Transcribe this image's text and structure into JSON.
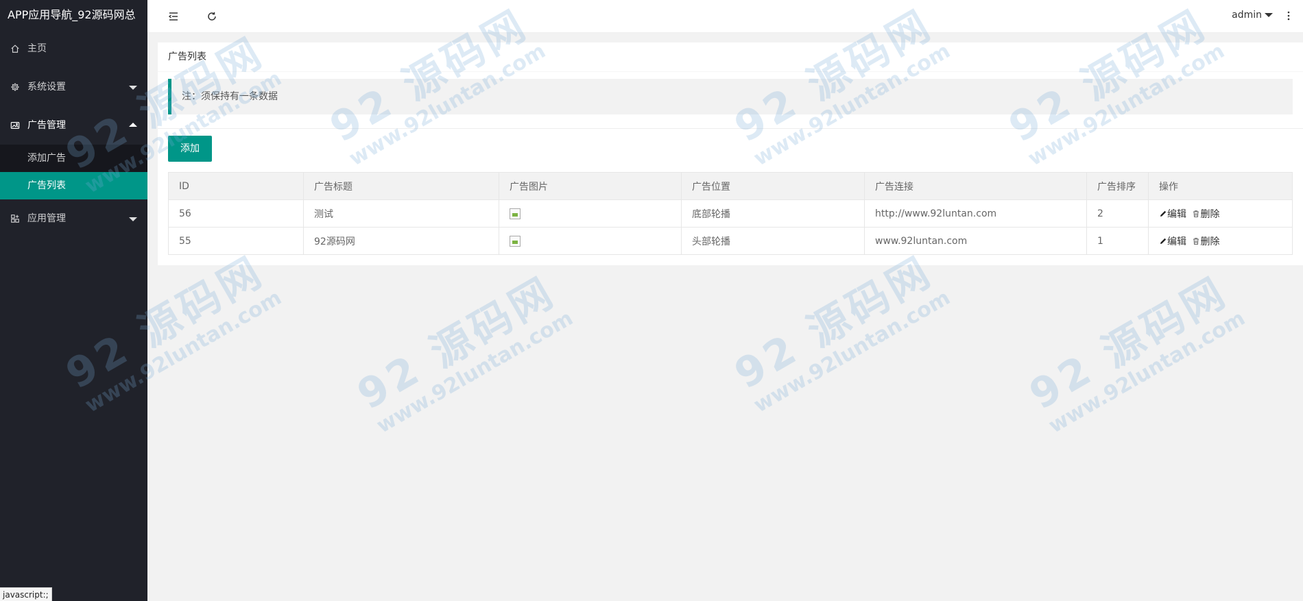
{
  "app": {
    "title": "APP应用导航_92源码网总"
  },
  "sidebar": {
    "items": [
      {
        "label": "主页",
        "icon": "home-icon"
      },
      {
        "label": "系统设置",
        "icon": "gear-icon"
      },
      {
        "label": "广告管理",
        "icon": "image-icon",
        "children": [
          {
            "label": "添加广告"
          },
          {
            "label": "广告列表"
          }
        ]
      },
      {
        "label": "应用管理",
        "icon": "apps-icon"
      }
    ]
  },
  "header": {
    "user": "admin"
  },
  "page": {
    "title": "广告列表",
    "notice": "注：须保持有一条数据",
    "add_label": "添加"
  },
  "table": {
    "columns": [
      "ID",
      "广告标题",
      "广告图片",
      "广告位置",
      "广告连接",
      "广告排序",
      "操作"
    ],
    "rows": [
      {
        "id": "56",
        "title": "测试",
        "position": "底部轮播",
        "link": "http://www.92luntan.com",
        "sort": "2"
      },
      {
        "id": "55",
        "title": "92源码网",
        "position": "头部轮播",
        "link": "www.92luntan.com",
        "sort": "1"
      }
    ],
    "edit_label": "编辑",
    "delete_label": "删除"
  },
  "watermark": {
    "brand": "92 源码网",
    "url": "www.92luntan.com"
  },
  "status_bar": {
    "text": "javascript:;"
  },
  "colors": {
    "accent": "#009688",
    "sidebar": "#20222a"
  }
}
